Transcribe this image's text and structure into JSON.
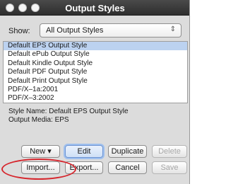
{
  "window": {
    "title": "Output Styles"
  },
  "show": {
    "label": "Show:",
    "selected": "All Output Styles",
    "arrows": "⇕"
  },
  "styles": [
    "Default EPS Output Style",
    "Default ePub Output Style",
    "Default Kindle Output Style",
    "Default PDF Output Style",
    "Default Print Output Style",
    "PDF/X–1a:2001",
    "PDF/X–3:2002"
  ],
  "info": {
    "style_name": "Style Name: Default EPS Output Style",
    "output_media": "Output Media: EPS"
  },
  "buttons": {
    "new": "New ▾",
    "edit": "Edit",
    "duplicate": "Duplicate",
    "delete": "Delete",
    "import": "Import...",
    "export": "Export...",
    "cancel": "Cancel",
    "save": "Save"
  },
  "colors": {
    "selection": "#bcd2f0",
    "annotation": "#d6262d",
    "titlebar": "#3a3a3a"
  }
}
